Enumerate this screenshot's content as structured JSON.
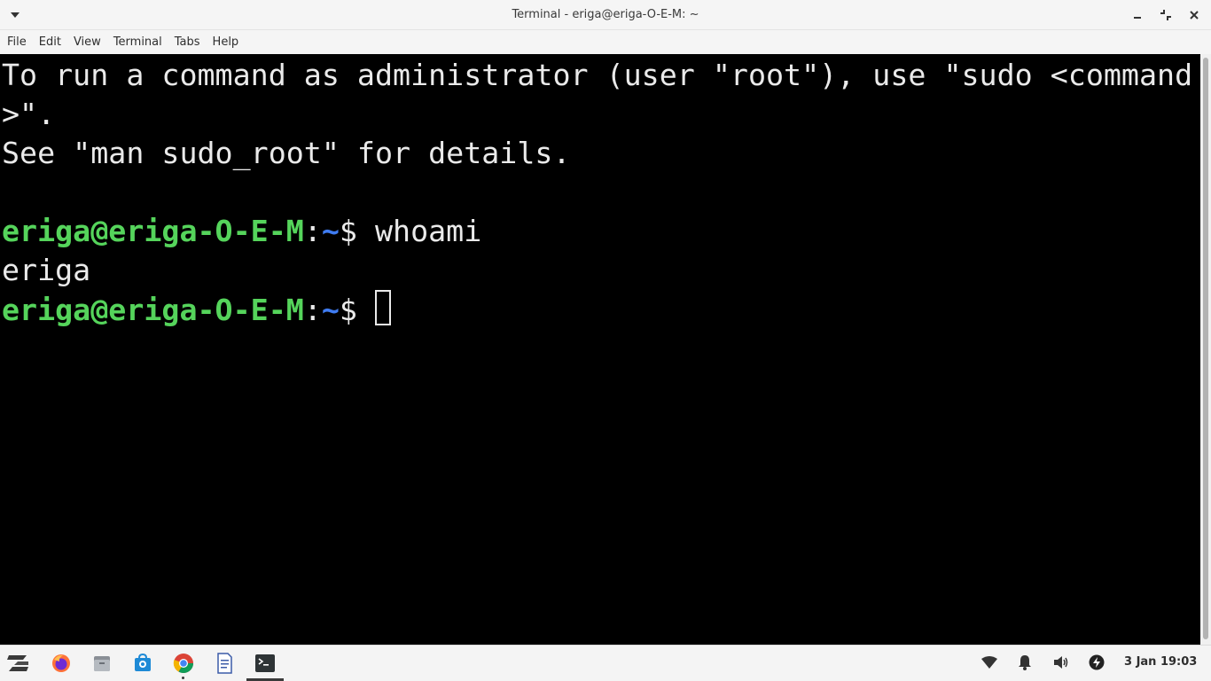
{
  "window": {
    "title": "Terminal - eriga@eriga-O-E-M: ~"
  },
  "menubar": {
    "items": [
      "File",
      "Edit",
      "View",
      "Terminal",
      "Tabs",
      "Help"
    ]
  },
  "terminal": {
    "line1": "To run a command as administrator (user \"root\"), use \"sudo <command",
    "line2": ">\".",
    "line3": "See \"man sudo_root\" for details.",
    "prompt_user_host": "eriga@eriga-O-E-M",
    "prompt_colon": ":",
    "prompt_path": "~",
    "prompt_symbol": "$ ",
    "command1": "whoami",
    "output1": "eriga",
    "colors": {
      "background": "#000000",
      "foreground": "#eaeaea",
      "user_host": "#55d45b",
      "path": "#3f7cf2"
    }
  },
  "taskbar": {
    "apps": [
      {
        "name": "Zorin menu",
        "icon": "zorin-logo-icon"
      },
      {
        "name": "Firefox",
        "icon": "firefox-icon"
      },
      {
        "name": "Files",
        "icon": "files-icon"
      },
      {
        "name": "Software",
        "icon": "software-store-icon"
      },
      {
        "name": "Chrome",
        "icon": "chrome-icon"
      },
      {
        "name": "Text Editor",
        "icon": "document-icon"
      },
      {
        "name": "Terminal",
        "icon": "terminal-icon"
      }
    ],
    "tray": [
      "wifi-icon",
      "notification-bell-icon",
      "volume-icon",
      "power-icon"
    ],
    "clock": "3 Jan 19:03"
  }
}
